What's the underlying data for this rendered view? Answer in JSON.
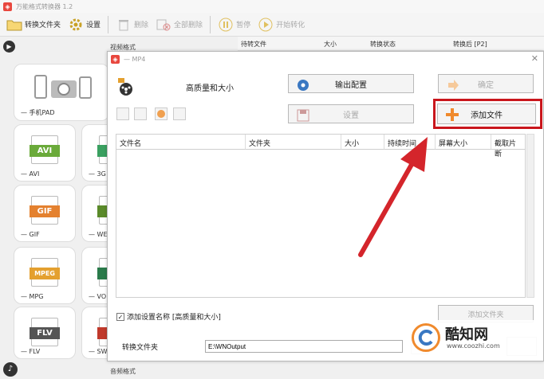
{
  "app": {
    "title": "万能格式转换器 1.2"
  },
  "toolbar": {
    "add_folder": "转换文件夹",
    "settings": "设置",
    "delete": "删除",
    "delete_all": "全部删除",
    "pause": "暂停",
    "start": "开始转化"
  },
  "left": {
    "video_section": "视频格式",
    "audio_section": "音频格式",
    "tiles": [
      {
        "label": "— 手机PAD"
      },
      {
        "fmt": "AVI",
        "label": "— AVI",
        "color": "#6aaa3a"
      },
      {
        "fmt": "3",
        "label": "— 3G",
        "color": "#3aa060"
      },
      {
        "fmt": "GIF",
        "label": "— GIF",
        "color": "#e4812f"
      },
      {
        "fmt": "W",
        "label": "— WE",
        "color": "#5a8a2a"
      },
      {
        "fmt": "MPEG",
        "label": "— MPG",
        "color": "#e4a02f"
      },
      {
        "fmt": "V",
        "label": "— VO",
        "color": "#2a7a4a"
      },
      {
        "fmt": "FLV",
        "label": "— FLV",
        "color": "#555555"
      },
      {
        "fmt": "S",
        "label": "— SW",
        "color": "#c0392b"
      }
    ]
  },
  "list_header": {
    "file": "待转文件",
    "size": "大小",
    "status": "转换状态",
    "after": "转换后 [P2]"
  },
  "dialog": {
    "title": "— MP4",
    "preset": "高质量和大小",
    "output_config": "输出配置",
    "confirm": "确定",
    "settings": "设置",
    "add_file": "添加文件",
    "columns": [
      "文件名",
      "文件夹",
      "大小",
      "持续时间",
      "屏幕大小",
      "截取片断"
    ],
    "add_setting_name": "添加设置名称 [高质量和大小]",
    "output_folder_label": "转换文件夹",
    "output_folder_value": "E:\\WNOutput",
    "hidden_button": "添加文件夹"
  },
  "watermark": {
    "name": "酷知网",
    "url": "www.coozhi.com"
  },
  "colors": {
    "arrow": "#d4252b",
    "highlight": "#c9161c",
    "plus": "#f08a2d"
  }
}
